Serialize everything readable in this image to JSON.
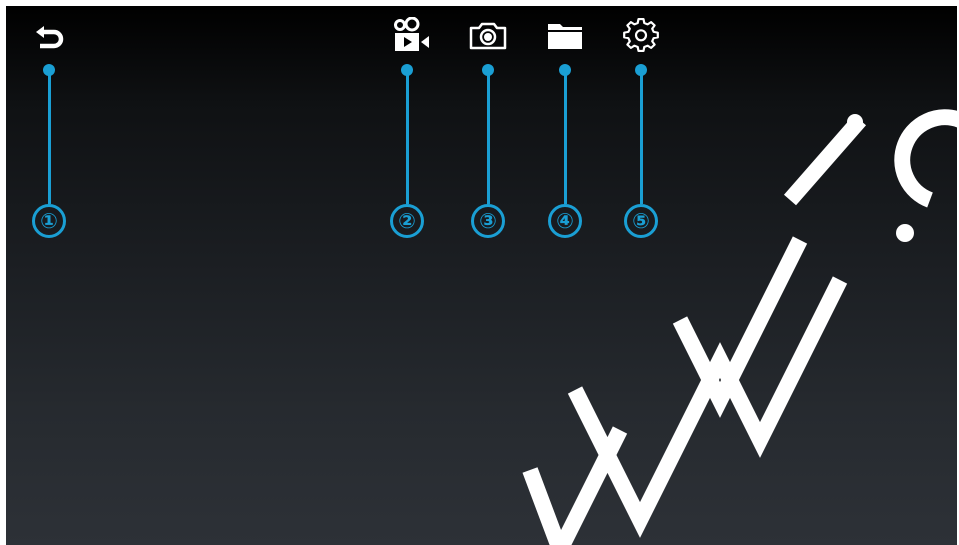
{
  "toolbar": {
    "items": [
      {
        "icon": "back-arrow-icon",
        "callout": "①"
      },
      {
        "icon": "video-camera-icon",
        "callout": "②"
      },
      {
        "icon": "camera-icon",
        "callout": "③"
      },
      {
        "icon": "folder-icon",
        "callout": "④"
      },
      {
        "icon": "gear-icon",
        "callout": "⑤"
      }
    ]
  },
  "colors": {
    "accent": "#1a9fd4",
    "icon": "#ffffff",
    "watermark": "#ffffff"
  }
}
